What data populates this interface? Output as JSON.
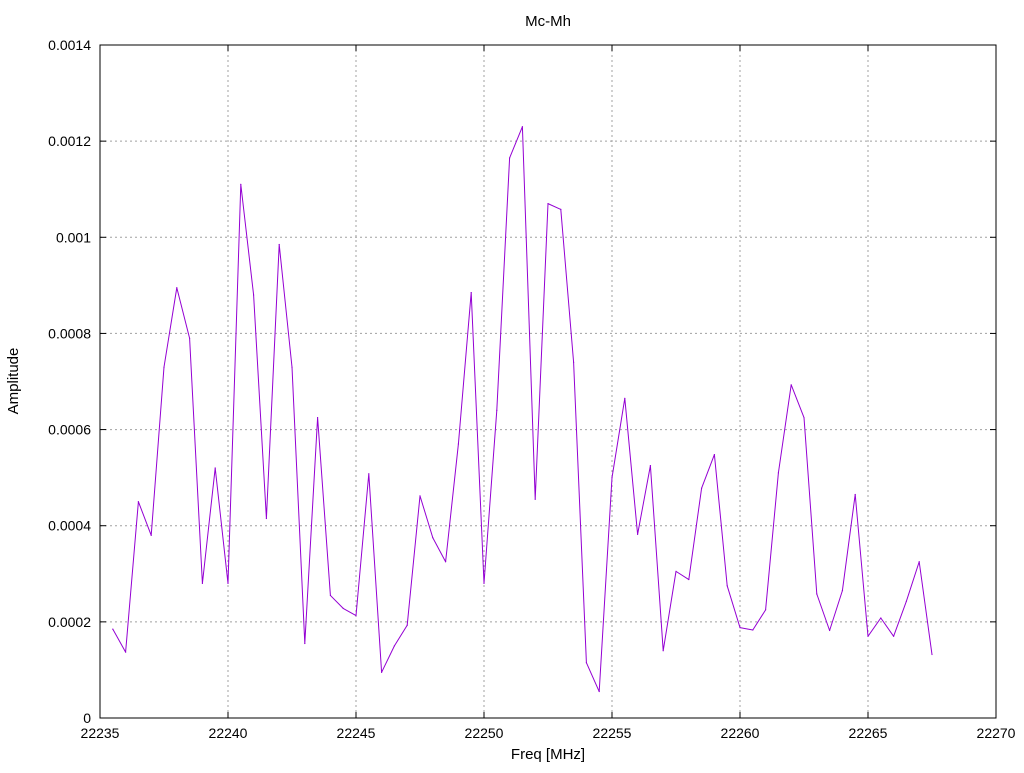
{
  "chart_data": {
    "type": "line",
    "title": "Mc-Mh",
    "xlabel": "Freq [MHz]",
    "ylabel": "Amplitude",
    "xlim": [
      22235,
      22270
    ],
    "ylim": [
      0,
      0.0014
    ],
    "grid": true,
    "x_ticks": [
      "22235",
      "22240",
      "22245",
      "22250",
      "22255",
      "22260",
      "22265",
      "22270"
    ],
    "y_ticks": [
      "0",
      "0.0002",
      "0.0004",
      "0.0006",
      "0.0008",
      "0.001",
      "0.0012",
      "0.0014"
    ],
    "series": [
      {
        "color": "#9400d3",
        "x": [
          22235.5,
          22236.0,
          22236.5,
          22237.0,
          22237.5,
          22238.0,
          22238.5,
          22239.0,
          22239.5,
          22240.0,
          22240.5,
          22241.0,
          22241.5,
          22242.0,
          22242.5,
          22243.0,
          22243.5,
          22244.0,
          22244.5,
          22245.0,
          22245.5,
          22246.0,
          22246.5,
          22247.0,
          22247.5,
          22248.0,
          22248.5,
          22249.0,
          22249.5,
          22250.0,
          22250.5,
          22251.0,
          22251.5,
          22252.0,
          22252.5,
          22253.0,
          22253.5,
          22254.0,
          22254.5,
          22255.0,
          22255.5,
          22256.0,
          22256.5,
          22257.0,
          22257.5,
          22258.0,
          22258.5,
          22259.0,
          22259.5,
          22260.0,
          22260.5,
          22261.0,
          22261.5,
          22262.0,
          22262.5,
          22263.0,
          22263.5,
          22264.0,
          22264.5,
          22265.0,
          22265.5,
          22266.0,
          22266.5,
          22267.0,
          22267.5
        ],
        "y": [
          0.000185,
          0.000137,
          0.00045,
          0.00038,
          0.00073,
          0.000895,
          0.00079,
          0.00028,
          0.00052,
          0.00028,
          0.00111,
          0.00088,
          0.000415,
          0.000985,
          0.00073,
          0.000155,
          0.000625,
          0.000255,
          0.000228,
          0.000213,
          0.000508,
          9.5e-05,
          0.00015,
          0.000193,
          0.000462,
          0.000375,
          0.000325,
          0.00057,
          0.000885,
          0.00028,
          0.00064,
          0.001165,
          0.00123,
          0.000455,
          0.00107,
          0.001058,
          0.00074,
          0.000115,
          5.5e-05,
          0.0005,
          0.000665,
          0.000382,
          0.000525,
          0.00014,
          0.000305,
          0.000288,
          0.000478,
          0.000548,
          0.000275,
          0.000188,
          0.000183,
          0.000225,
          0.00051,
          0.000693,
          0.000625,
          0.000258,
          0.000182,
          0.000265,
          0.000465,
          0.00017,
          0.000208,
          0.00017,
          0.000243,
          0.000325,
          0.000132
        ]
      }
    ]
  }
}
